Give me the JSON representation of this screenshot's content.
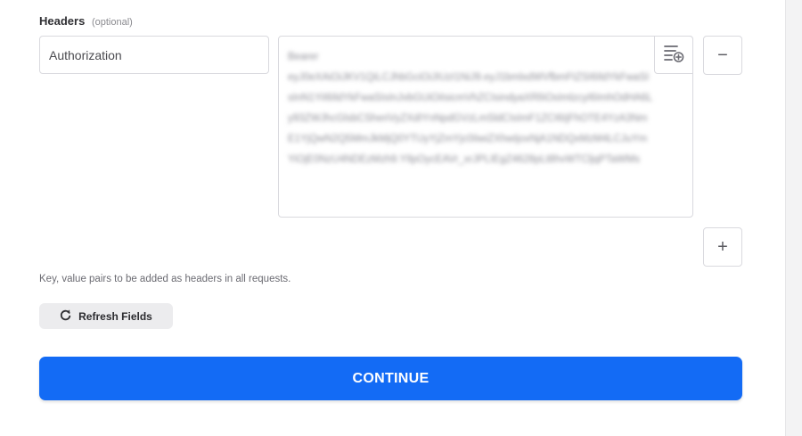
{
  "headers_section": {
    "label": "Headers",
    "optional": "(optional)",
    "key_value": "Authorization",
    "value_text": "Bearer\neyJ0eXAiOiJKV1QiLCJhbGciOiJIUzI1NiJ9.eyJ1bmlxdWVfbmFtZSI6IldYkFwaSIsInN1YiI6IldYkFwaSIsInJvbGUiOiIsicmVhZCIsindyaXRlIiOsImlzcyI6ImhOdHA6Ly93ZWJhcGlsbCSheriVyZXdIYnNpdGVzLmSldCIsImF1ZCI6IjFhOTE4YzA3NmE1YjQwN2Q5MmJkMjQ0YTUyYjZmYjc0IiwiZXhwIjoxNjA1NDQxMzM4LCJuYmYiOjE0NzU4NDEzMzh9.YIlpOycEAVr_xrJPLIEgZ4628pLt8hvWTCljqPTaWMs",
    "remove_label": "−",
    "add_label": "+",
    "helper": "Key, value pairs to be added as headers in all requests."
  },
  "refresh": {
    "label": "Refresh Fields",
    "icon": "refresh-icon"
  },
  "continue": {
    "label": "CONTINUE"
  },
  "icons": {
    "insert_field": "insert-field-icon"
  },
  "colors": {
    "primary": "#136bf5",
    "border": "#d9d9de",
    "refresh_bg": "#ececee"
  }
}
